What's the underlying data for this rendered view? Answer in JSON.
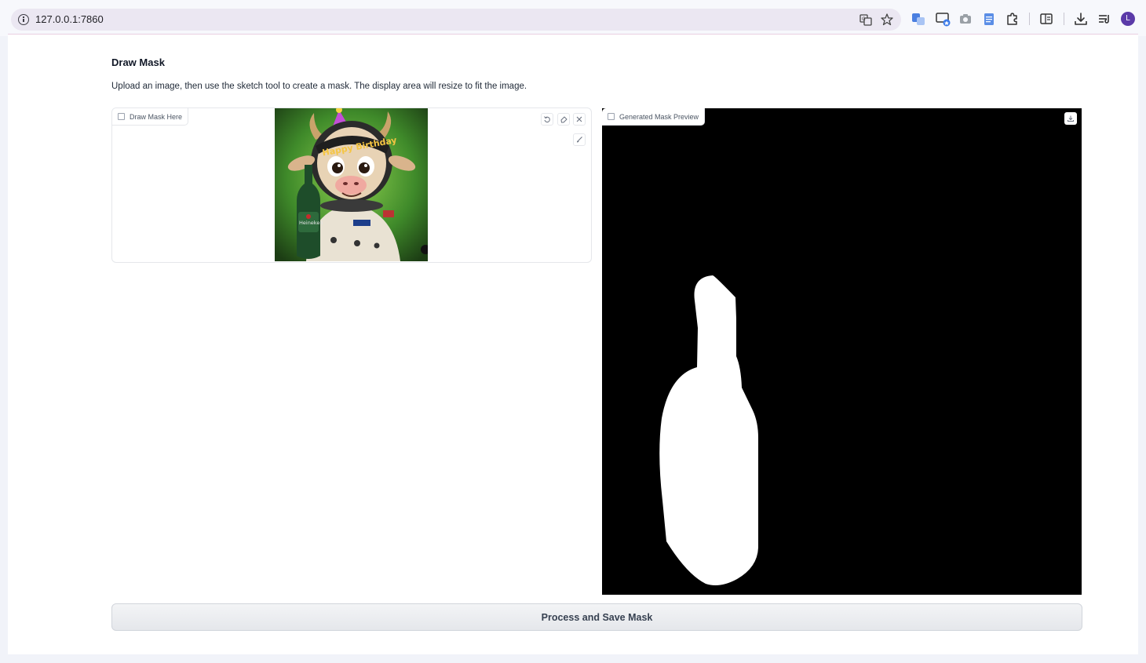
{
  "browser": {
    "url": "127.0.0.1:7860",
    "avatar_letter": "L",
    "icons": [
      "info-icon",
      "translate-icon",
      "star-icon",
      "translate-extension-icon",
      "cast-icon",
      "camera-icon",
      "document-icon",
      "extensions-icon",
      "reading-list-icon",
      "download-icon",
      "media-icon"
    ]
  },
  "app": {
    "title": "Draw Mask",
    "description": "Upload an image, then use the sketch tool to create a mask. The display area will resize to fit the image.",
    "sketch_label": "Draw Mask Here",
    "preview_label": "Generated Mask Preview",
    "process_button": "Process and Save Mask",
    "sketch_image_text": "Happy Birthday",
    "bottle_label_text": "Heineken"
  },
  "colors": {
    "accent": "#5b3aa8",
    "mask_background": "#000000",
    "mask_foreground": "#ffffff"
  }
}
